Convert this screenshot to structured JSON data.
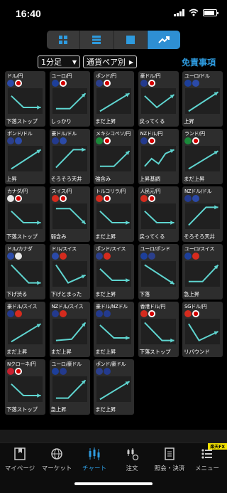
{
  "status": {
    "time": "16:40"
  },
  "view_tabs": [
    {
      "icon": "grid-view-icon",
      "active": false
    },
    {
      "icon": "list-view-icon",
      "active": false
    },
    {
      "icon": "single-view-icon",
      "active": false
    },
    {
      "icon": "trend-view-icon",
      "active": true
    }
  ],
  "filters": {
    "timeframe": "1分足",
    "sort": "通貨ペア別",
    "disclaimer": "免責事項"
  },
  "pairs": [
    {
      "name": "ドル/円",
      "flags": [
        "#2b4aa8",
        "#ffffff"
      ],
      "trend": "下落ストップ",
      "shape": [
        [
          0.1,
          0.3
        ],
        [
          0.45,
          0.75
        ],
        [
          0.95,
          0.75
        ]
      ]
    },
    {
      "name": "ユーロ/円",
      "flags": [
        "#1d3f9a",
        "#ffffff"
      ],
      "trend": "しっかり",
      "shape": [
        [
          0.1,
          0.8
        ],
        [
          0.5,
          0.8
        ],
        [
          0.95,
          0.2
        ]
      ]
    },
    {
      "name": "ポンド/円",
      "flags": [
        "#2b3f8c",
        "#ffffff"
      ],
      "trend": "まだ上昇",
      "shape": [
        [
          0.1,
          0.9
        ],
        [
          0.95,
          0.2
        ]
      ]
    },
    {
      "name": "豪ドル/円",
      "flags": [
        "#233a8e",
        "#ffffff"
      ],
      "trend": "戻ってくる",
      "shape": [
        [
          0.1,
          0.3
        ],
        [
          0.45,
          0.75
        ],
        [
          0.95,
          0.25
        ]
      ]
    },
    {
      "name": "ユーロ/ドル",
      "flags": [
        "#1d3f9a",
        "#2b4aa8"
      ],
      "trend": "上昇",
      "shape": [
        [
          0.1,
          0.9
        ],
        [
          0.95,
          0.15
        ]
      ]
    },
    {
      "name": "ポンド/ドル",
      "flags": [
        "#2b3f8c",
        "#2b4aa8"
      ],
      "trend": "上昇",
      "shape": [
        [
          0.1,
          0.9
        ],
        [
          0.95,
          0.15
        ]
      ]
    },
    {
      "name": "豪ドル/ドル",
      "flags": [
        "#233a8e",
        "#2b4aa8"
      ],
      "trend": "そろそろ天井",
      "shape": [
        [
          0.1,
          0.85
        ],
        [
          0.6,
          0.15
        ],
        [
          0.95,
          0.15
        ]
      ]
    },
    {
      "name": "メキシコペソ/円",
      "flags": [
        "#1a8a3a",
        "#ffffff"
      ],
      "trend": "強含み",
      "shape": [
        [
          0.1,
          0.8
        ],
        [
          0.5,
          0.8
        ],
        [
          0.95,
          0.2
        ]
      ]
    },
    {
      "name": "NZドル/円",
      "flags": [
        "#233a8e",
        "#ffffff"
      ],
      "trend": "上昇基調",
      "shape": [
        [
          0.1,
          0.8
        ],
        [
          0.3,
          0.5
        ],
        [
          0.5,
          0.7
        ],
        [
          0.7,
          0.3
        ],
        [
          0.95,
          0.15
        ]
      ]
    },
    {
      "name": "ランド/円",
      "flags": [
        "#1a8a3a",
        "#ffffff"
      ],
      "trend": "まだ上昇",
      "shape": [
        [
          0.1,
          0.9
        ],
        [
          0.95,
          0.2
        ]
      ]
    },
    {
      "name": "カナダ/円",
      "flags": [
        "#e8e8e8",
        "#ffffff"
      ],
      "trend": "下落ストップ",
      "shape": [
        [
          0.1,
          0.3
        ],
        [
          0.45,
          0.75
        ],
        [
          0.95,
          0.75
        ]
      ]
    },
    {
      "name": "スイス/円",
      "flags": [
        "#d52b1e",
        "#ffffff"
      ],
      "trend": "弱含み",
      "shape": [
        [
          0.1,
          0.2
        ],
        [
          0.5,
          0.2
        ],
        [
          0.95,
          0.8
        ]
      ]
    },
    {
      "name": "トルコリラ/円",
      "flags": [
        "#d52b1e",
        "#ffffff"
      ],
      "trend": "まだ上昇",
      "shape": [
        [
          0.1,
          0.3
        ],
        [
          0.45,
          0.75
        ],
        [
          0.95,
          0.75
        ]
      ]
    },
    {
      "name": "人民元/円",
      "flags": [
        "#d52b1e",
        "#ffffff"
      ],
      "trend": "戻ってくる",
      "shape": [
        [
          0.1,
          0.3
        ],
        [
          0.45,
          0.75
        ],
        [
          0.95,
          0.75
        ]
      ]
    },
    {
      "name": "NZドル/ドル",
      "flags": [
        "#233a8e",
        "#2b4aa8"
      ],
      "trend": "そろそろ天井",
      "shape": [
        [
          0.1,
          0.85
        ],
        [
          0.6,
          0.15
        ],
        [
          0.95,
          0.15
        ]
      ]
    },
    {
      "name": "ドル/カナダ",
      "flags": [
        "#2b4aa8",
        "#e8e8e8"
      ],
      "trend": "下げ渋る",
      "shape": [
        [
          0.1,
          0.15
        ],
        [
          0.6,
          0.85
        ],
        [
          0.95,
          0.85
        ]
      ]
    },
    {
      "name": "ドル/スイス",
      "flags": [
        "#2b4aa8",
        "#d52b1e"
      ],
      "trend": "下げとまった",
      "shape": [
        [
          0.1,
          0.15
        ],
        [
          0.45,
          0.85
        ],
        [
          0.95,
          0.55
        ]
      ]
    },
    {
      "name": "ポンド/スイス",
      "flags": [
        "#2b3f8c",
        "#d52b1e"
      ],
      "trend": "まだ上昇",
      "shape": [
        [
          0.1,
          0.3
        ],
        [
          0.45,
          0.75
        ],
        [
          0.95,
          0.75
        ]
      ]
    },
    {
      "name": "ユーロ/ポンド",
      "flags": [
        "#1d3f9a",
        "#2b3f8c"
      ],
      "trend": "下落",
      "shape": [
        [
          0.1,
          0.15
        ],
        [
          0.95,
          0.9
        ]
      ]
    },
    {
      "name": "ユーロ/スイス",
      "flags": [
        "#1d3f9a",
        "#d52b1e"
      ],
      "trend": "急上昇",
      "shape": [
        [
          0.1,
          0.8
        ],
        [
          0.5,
          0.8
        ],
        [
          0.95,
          0.15
        ]
      ]
    },
    {
      "name": "豪ドル/スイス",
      "flags": [
        "#233a8e",
        "#d52b1e"
      ],
      "trend": "まだ上昇",
      "shape": [
        [
          0.1,
          0.9
        ],
        [
          0.95,
          0.2
        ]
      ]
    },
    {
      "name": "NZドル/スイス",
      "flags": [
        "#233a8e",
        "#d52b1e"
      ],
      "trend": "まだ上昇",
      "shape": [
        [
          0.1,
          0.85
        ],
        [
          0.55,
          0.8
        ],
        [
          0.95,
          0.15
        ]
      ]
    },
    {
      "name": "豪ドル/NZドル",
      "flags": [
        "#233a8e",
        "#233a8e"
      ],
      "trend": "まだ上昇",
      "shape": [
        [
          0.1,
          0.25
        ],
        [
          0.5,
          0.75
        ],
        [
          0.95,
          0.75
        ]
      ]
    },
    {
      "name": "香港ドル/円",
      "flags": [
        "#d52b1e",
        "#ffffff"
      ],
      "trend": "下落ストップ",
      "shape": [
        [
          0.1,
          0.15
        ],
        [
          0.6,
          0.85
        ],
        [
          0.95,
          0.85
        ]
      ]
    },
    {
      "name": "SGドル/円",
      "flags": [
        "#d52b1e",
        "#ffffff"
      ],
      "trend": "リバウンド",
      "shape": [
        [
          0.1,
          0.2
        ],
        [
          0.4,
          0.85
        ],
        [
          0.95,
          0.5
        ]
      ]
    },
    {
      "name": "Nクローネ/円",
      "flags": [
        "#c8202f",
        "#ffffff"
      ],
      "trend": "下落ストップ",
      "shape": [
        [
          0.1,
          0.3
        ],
        [
          0.45,
          0.75
        ],
        [
          0.95,
          0.75
        ]
      ]
    },
    {
      "name": "ユーロ/豪ドル",
      "flags": [
        "#1d3f9a",
        "#233a8e"
      ],
      "trend": "急上昇",
      "shape": [
        [
          0.1,
          0.85
        ],
        [
          0.45,
          0.85
        ],
        [
          0.95,
          0.15
        ]
      ]
    },
    {
      "name": "ポンド/豪ドル",
      "flags": [
        "#2b3f8c",
        "#233a8e"
      ],
      "trend": "まだ上昇",
      "shape": [
        [
          0.1,
          0.9
        ],
        [
          0.95,
          0.2
        ]
      ]
    }
  ],
  "tabs": [
    {
      "label": "マイページ",
      "icon": "bookmark-icon",
      "active": false
    },
    {
      "label": "マーケット",
      "icon": "globe-icon",
      "active": false
    },
    {
      "label": "チャート",
      "icon": "candlestick-icon",
      "active": true
    },
    {
      "label": "注文",
      "icon": "order-icon",
      "active": false
    },
    {
      "label": "照会・決済",
      "icon": "document-icon",
      "active": false
    },
    {
      "label": "メニュー",
      "icon": "menu-icon",
      "active": false,
      "badge": "楽天FX"
    }
  ],
  "colors": {
    "accent": "#2e9bdf",
    "trend_line": "#5fd5d0",
    "cell_bg": "#2d2d2d"
  }
}
